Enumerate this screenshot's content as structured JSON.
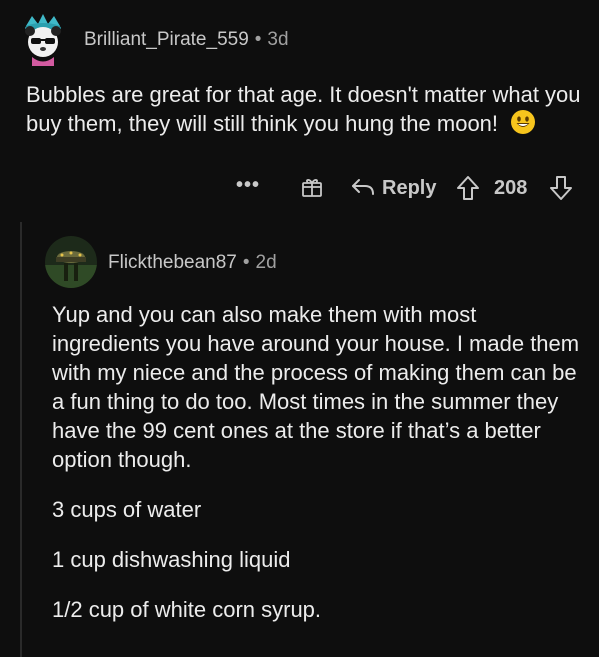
{
  "comment1": {
    "username": "Brilliant_Pirate_559",
    "separator": "•",
    "time": "3d",
    "text": "Bubbles are great for that age. It doesn't matter what you buy them, they will still think you hung the moon!",
    "emoji": "smiling-face"
  },
  "actions": {
    "more": "•••",
    "reply_label": "Reply",
    "score": "208"
  },
  "comment2": {
    "username": "Flickthebean87",
    "separator": "•",
    "time": "2d",
    "paragraphs": [
      "Yup and you can also make them with most ingredients you have around your house. I made them with my niece and the process of making them can be a fun thing to do too. Most times in the summer they have the 99 cent ones at the store if that’s a better option though.",
      "3 cups of water",
      "1 cup dishwashing liquid",
      "1/2 cup of white corn syrup."
    ]
  }
}
